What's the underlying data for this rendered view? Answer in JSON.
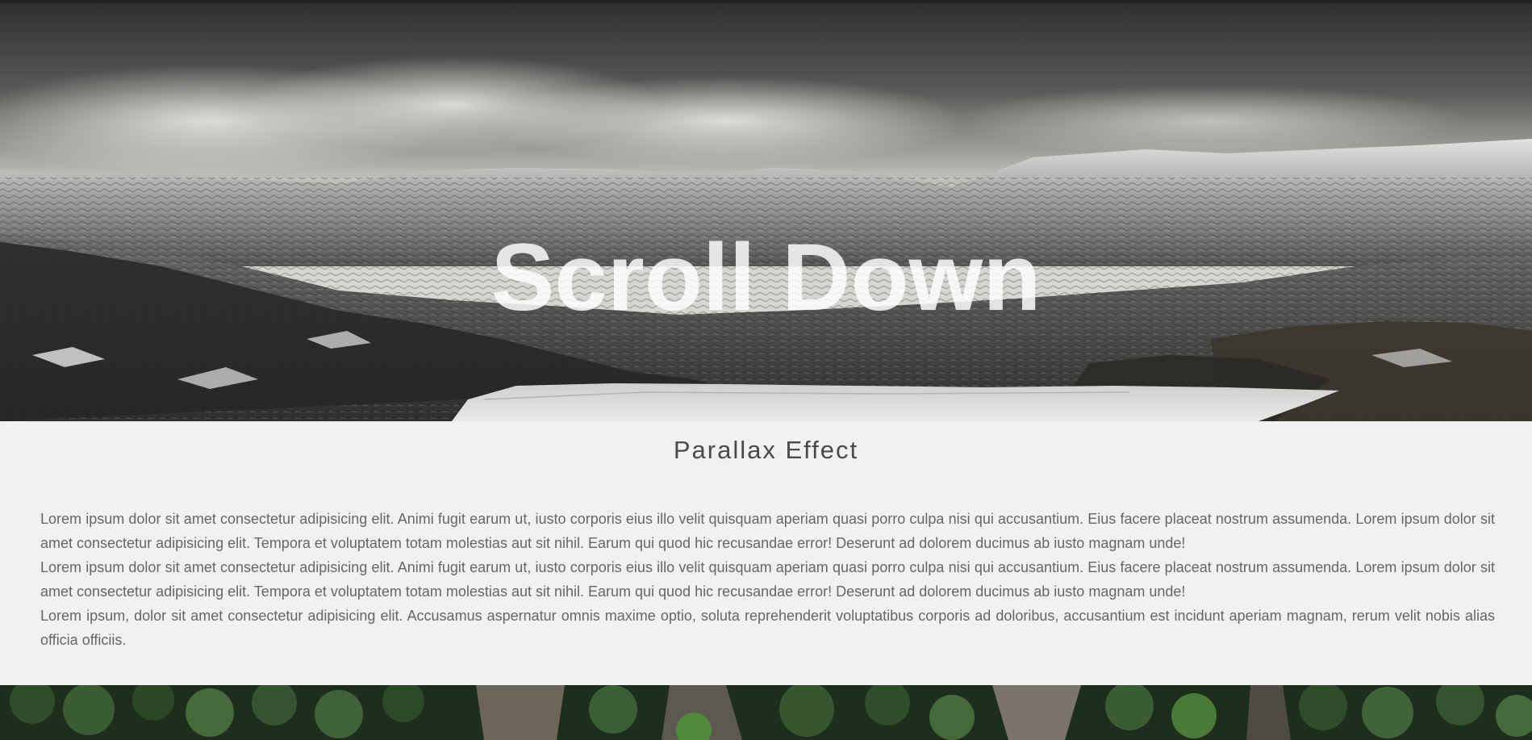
{
  "hero": {
    "title": "Scroll Down"
  },
  "section": {
    "heading": "Parallax Effect",
    "paragraphs": [
      "Lorem ipsum dolor sit amet consectetur adipisicing elit. Animi fugit earum ut, iusto corporis eius illo velit quisquam aperiam quasi porro culpa nisi qui accusantium. Eius facere placeat nostrum assumenda. Lorem ipsum dolor sit amet consectetur adipisicing elit. Tempora et voluptatem totam molestias aut sit nihil. Earum qui quod hic recusandae error! Deserunt ad dolorem ducimus ab iusto magnam unde!",
      "Lorem ipsum dolor sit amet consectetur adipisicing elit. Animi fugit earum ut, iusto corporis eius illo velit quisquam aperiam quasi porro culpa nisi qui accusantium. Eius facere placeat nostrum assumenda. Lorem ipsum dolor sit amet consectetur adipisicing elit. Tempora et voluptatem totam molestias aut sit nihil. Earum qui quod hic recusandae error! Deserunt ad dolorem ducimus ab iusto magnam unde!",
      "Lorem ipsum, dolor sit amet consectetur adipisicing elit. Accusamus aspernatur omnis maxime optio, soluta reprehenderit voluptatibus corporis ad doloribus, accusantium est incidunt aperiam magnam, rerum velit nobis alias officia officiis."
    ]
  },
  "colors": {
    "page_background": "#f1f1f1",
    "heading_text": "#4a4a4a",
    "body_text": "#666666",
    "hero_title": "#ffffff"
  }
}
